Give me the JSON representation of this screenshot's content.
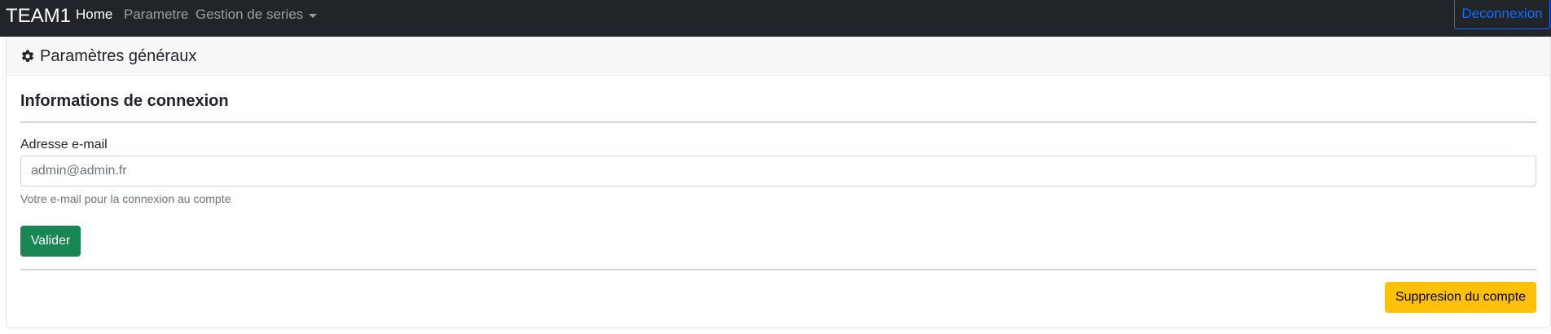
{
  "navbar": {
    "brand": "TEAM1",
    "items": [
      {
        "label": "Home",
        "active": true
      },
      {
        "label": "Parametre",
        "active": false
      },
      {
        "label": "Gestion de series",
        "active": false,
        "dropdown": true
      }
    ],
    "logout_label": "Deconnexion"
  },
  "card": {
    "header_icon": "gear-icon",
    "title": "Paramètres généraux",
    "section_title": "Informations de connexion",
    "email": {
      "label": "Adresse e-mail",
      "value": "admin@admin.fr",
      "help": "Votre e-mail pour la connexion au compte"
    },
    "validate_label": "Valider",
    "delete_label": "Suppresion du compte"
  },
  "colors": {
    "navbar_bg": "#212529",
    "primary": "#0d6efd",
    "success": "#198754",
    "warning": "#ffc107"
  }
}
